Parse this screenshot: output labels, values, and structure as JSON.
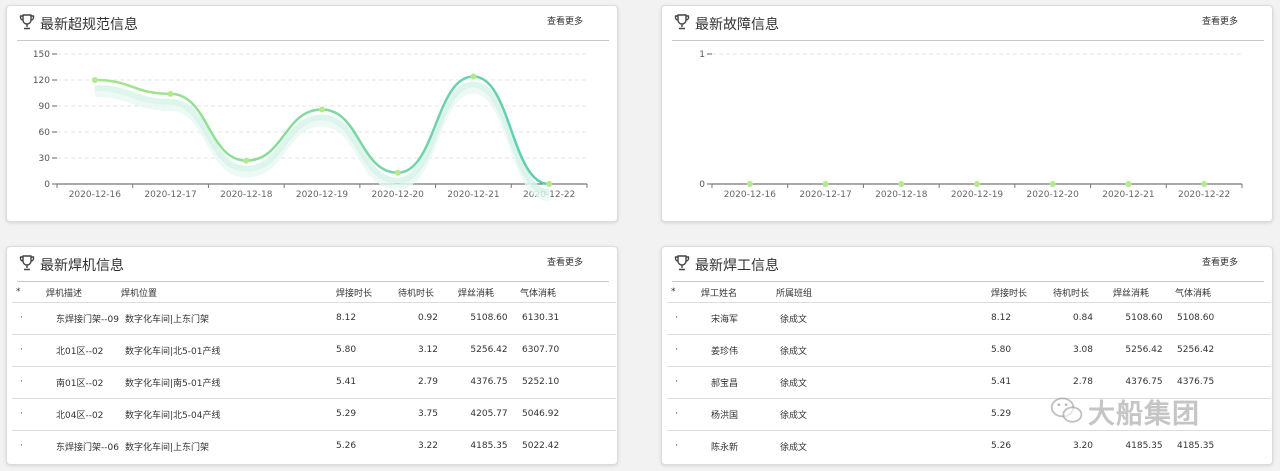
{
  "panels": {
    "violations": {
      "title": "最新超规范信息",
      "more": "查看更多"
    },
    "faults": {
      "title": "最新故障信息",
      "more": "查看更多"
    },
    "machines": {
      "title": "最新焊机信息",
      "more": "查看更多"
    },
    "welders": {
      "title": "最新焊工信息",
      "more": "查看更多"
    }
  },
  "chart_data": [
    {
      "type": "line",
      "title": "最新超规范信息",
      "categories": [
        "2020-12-16",
        "2020-12-17",
        "2020-12-18",
        "2020-12-19",
        "2020-12-20",
        "2020-12-21",
        "2020-12-22"
      ],
      "values": [
        120,
        104,
        27,
        86,
        13,
        124,
        0
      ],
      "ylim": [
        0,
        150
      ],
      "yticks": [
        0,
        30,
        60,
        90,
        120,
        150
      ],
      "smooth": true,
      "grid": true,
      "line_colors": [
        "#a6e58a",
        "#5ccdb4"
      ]
    },
    {
      "type": "line",
      "title": "最新故障信息",
      "categories": [
        "2020-12-16",
        "2020-12-17",
        "2020-12-18",
        "2020-12-19",
        "2020-12-20",
        "2020-12-21",
        "2020-12-22"
      ],
      "values": [
        0,
        0,
        0,
        0,
        0,
        0,
        0
      ],
      "ylim": [
        0,
        1
      ],
      "yticks": [
        0,
        1
      ],
      "grid": true,
      "line_colors": [
        "#a6e58a",
        "#5ccdb4"
      ]
    }
  ],
  "machines_table": {
    "headers": [
      "*",
      "焊机描述",
      "焊机位置",
      "焊接时长",
      "待机时长",
      "焊丝消耗",
      "气体消耗"
    ],
    "rows": [
      [
        "·",
        "东焊接门架--09",
        "数字化车间|上东门架",
        "8.12",
        "0.92",
        "5108.60",
        "6130.31"
      ],
      [
        "·",
        "北01区--02",
        "数字化车间|北5-01产线",
        "5.80",
        "3.12",
        "5256.42",
        "6307.70"
      ],
      [
        "·",
        "南01区--02",
        "数字化车间|南5-01产线",
        "5.41",
        "2.79",
        "4376.75",
        "5252.10"
      ],
      [
        "·",
        "北04区--02",
        "数字化车间|北5-04产线",
        "5.29",
        "3.75",
        "4205.77",
        "5046.92"
      ],
      [
        "·",
        "东焊接门架--06",
        "数字化车间|上东门架",
        "5.26",
        "3.22",
        "4185.35",
        "5022.42"
      ]
    ]
  },
  "welders_table": {
    "headers": [
      "*",
      "焊工姓名",
      "所属班组",
      "焊接时长",
      "待机时长",
      "焊丝消耗",
      "气体消耗"
    ],
    "rows": [
      [
        "·",
        "宋海军",
        "徐成文",
        "8.12",
        "0.84",
        "5108.60",
        "5108.60"
      ],
      [
        "·",
        "姜珍伟",
        "徐成文",
        "5.80",
        "3.08",
        "5256.42",
        "5256.42"
      ],
      [
        "·",
        "郝宝昌",
        "徐成文",
        "5.41",
        "2.78",
        "4376.75",
        "4376.75"
      ],
      [
        "·",
        "杨洪国",
        "徐成文",
        "5.29",
        "",
        "",
        ""
      ],
      [
        "·",
        "陈永新",
        "徐成文",
        "5.26",
        "3.20",
        "4185.35",
        "4185.35"
      ]
    ]
  },
  "watermark": {
    "text": "大船集团",
    "icon": "wechat-icon"
  }
}
